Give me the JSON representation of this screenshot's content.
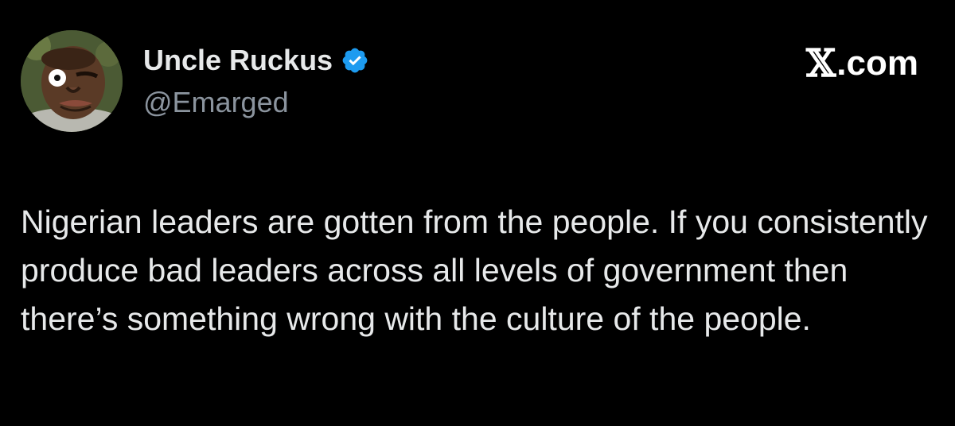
{
  "author": {
    "display_name": "Uncle Ruckus",
    "handle": "@Emarged",
    "verified": true,
    "avatar_icon": "cartoon-avatar",
    "verified_icon": "verified-badge-icon",
    "verified_color": "#1d9bf0"
  },
  "brand": {
    "mark": "𝕏",
    "suffix": ".com"
  },
  "tweet": {
    "text": "Nigerian leaders are gotten from the people. If you consistently produce bad leaders across all levels of government then there’s something wrong with the culture of the people."
  },
  "colors": {
    "background": "#000000",
    "primary_text": "#e7e9ea",
    "secondary_text": "#8b949e"
  }
}
